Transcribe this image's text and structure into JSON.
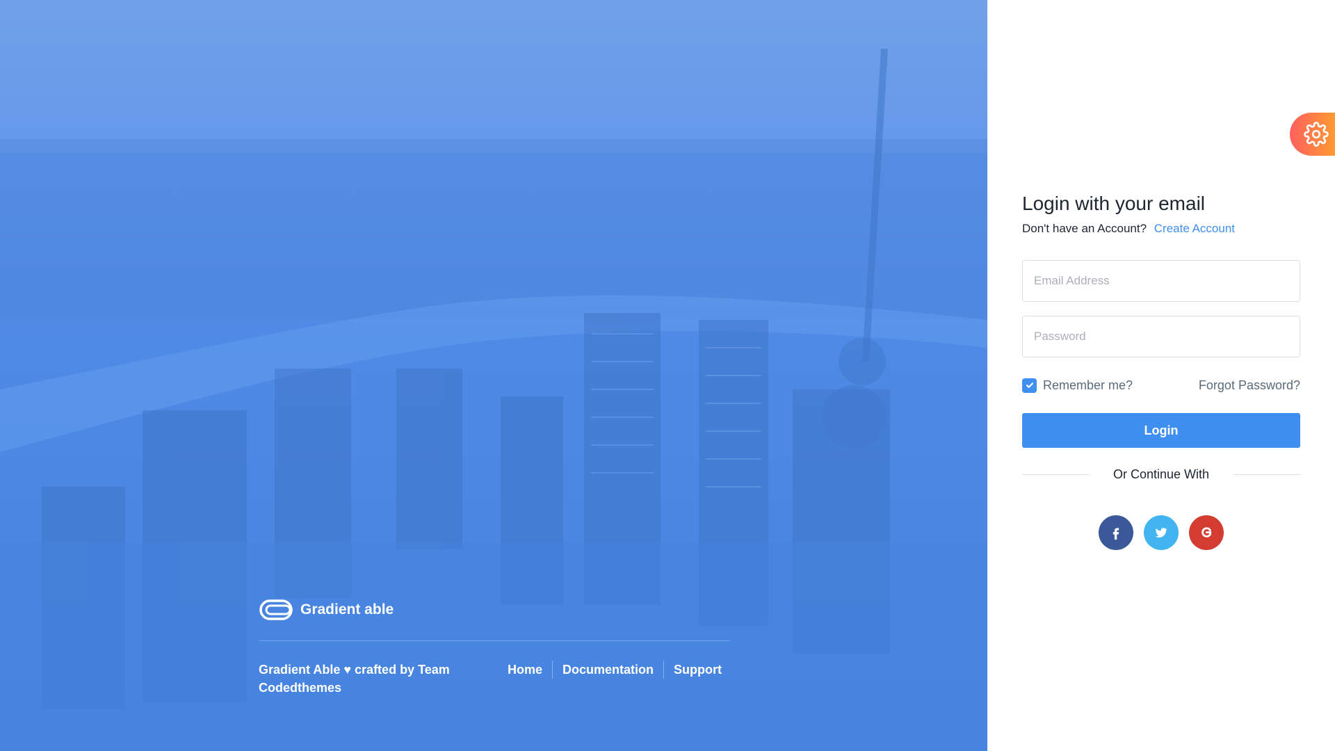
{
  "hero": {
    "brand_name": "Gradient able",
    "copyright": "Gradient Able ♥ crafted by Team Codedthemes",
    "links": [
      "Home",
      "Documentation",
      "Support"
    ]
  },
  "settings": {
    "icon": "gear-icon",
    "color_from": "#ff5f5f",
    "color_to": "#ffa62b"
  },
  "login": {
    "title": "Login with your email",
    "subtitle": "Don't have an Account?",
    "create_account": "Create Account",
    "email_placeholder": "Email Address",
    "password_placeholder": "Password",
    "remember_label": "Remember me?",
    "remember_checked": true,
    "forgot_label": "Forgot Password?",
    "submit_label": "Login",
    "divider_label": "Or Continue With"
  },
  "socials": [
    {
      "name": "facebook",
      "icon": "facebook-icon",
      "color": "#3b5998"
    },
    {
      "name": "twitter",
      "icon": "twitter-icon",
      "color": "#42b4ef"
    },
    {
      "name": "google",
      "icon": "google-icon",
      "color": "#d43c31"
    }
  ],
  "colors": {
    "accent": "#3f8ff0",
    "hero_overlay": "#4a86e2",
    "text": "#1d2630",
    "muted": "#5b6b79"
  }
}
